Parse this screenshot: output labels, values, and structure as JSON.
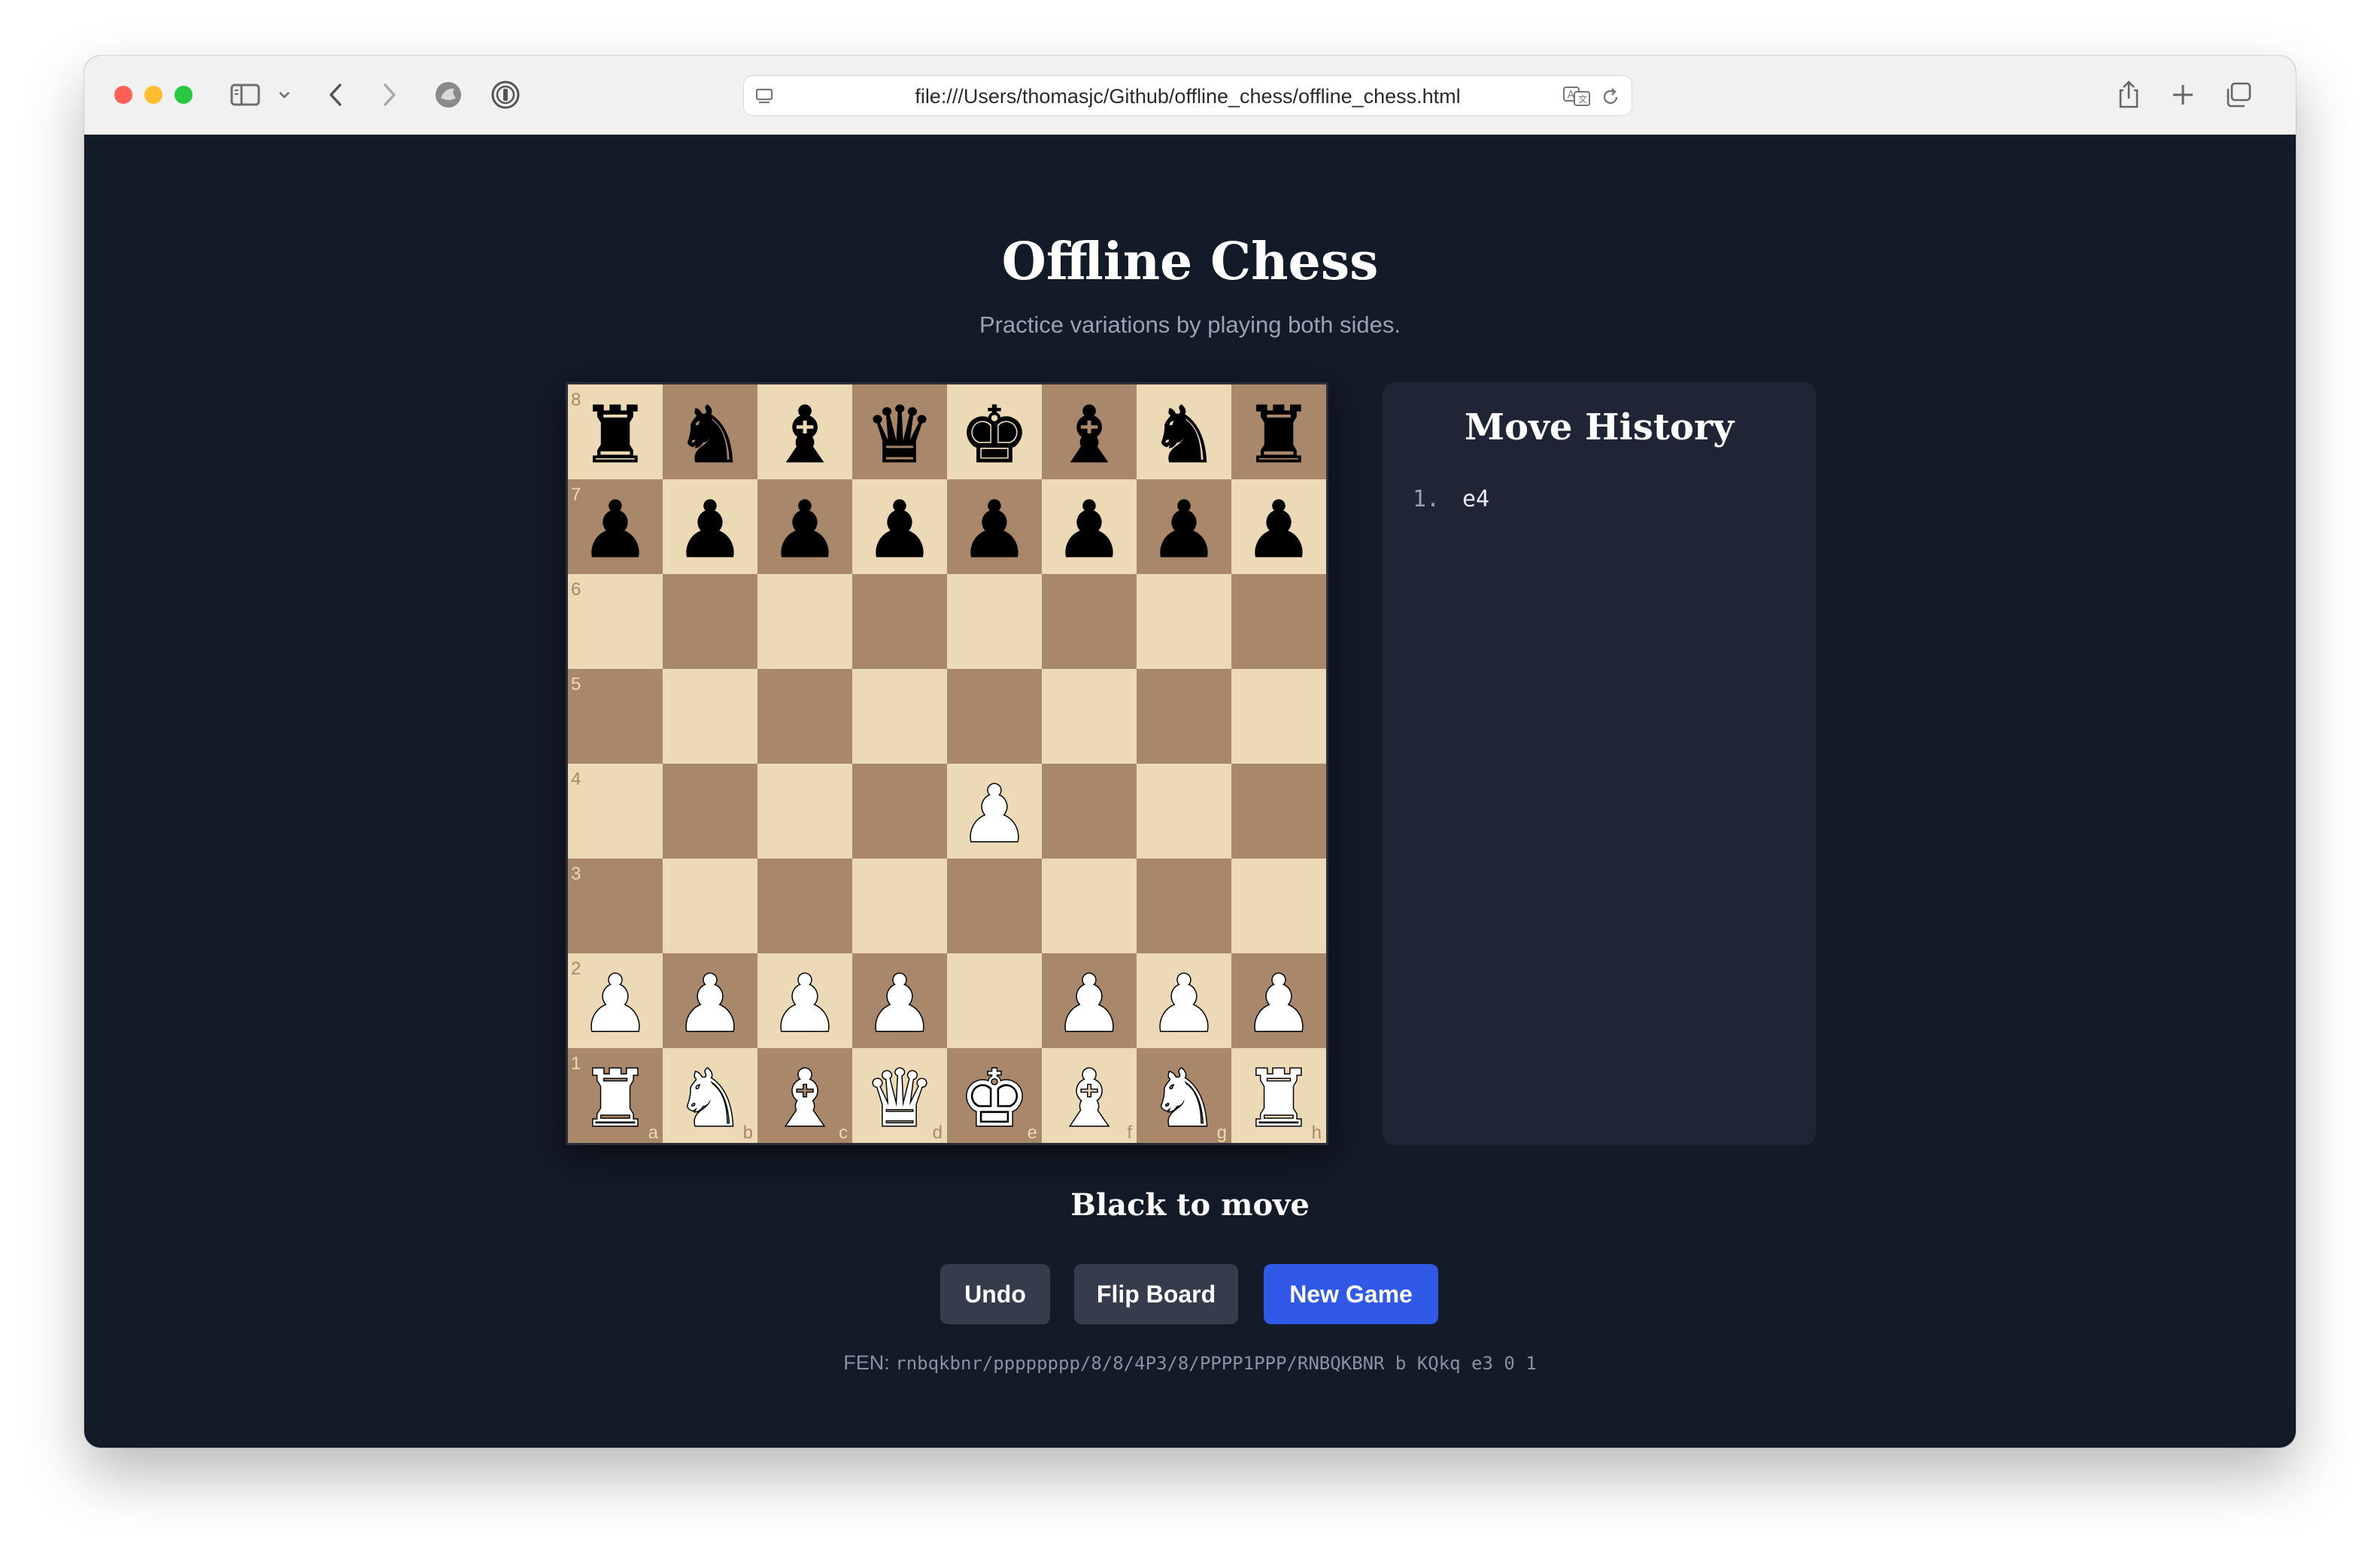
{
  "browser": {
    "url": "file:///Users/thomasjc/Github/offline_chess/offline_chess.html"
  },
  "page": {
    "title": "Offline Chess",
    "subtitle": "Practice variations by playing both sides.",
    "status": "Black to move"
  },
  "board": {
    "light_color": "#ecd9b6",
    "dark_color": "#a9876a",
    "rank_labels": [
      "8",
      "7",
      "6",
      "5",
      "4",
      "3",
      "2",
      "1"
    ],
    "file_labels": [
      "a",
      "b",
      "c",
      "d",
      "e",
      "f",
      "g",
      "h"
    ],
    "position": [
      [
        "r",
        "n",
        "b",
        "q",
        "k",
        "b",
        "n",
        "r"
      ],
      [
        "p",
        "p",
        "p",
        "p",
        "p",
        "p",
        "p",
        "p"
      ],
      [
        "",
        "",
        "",
        "",
        "",
        "",
        "",
        ""
      ],
      [
        "",
        "",
        "",
        "",
        "",
        "",
        "",
        ""
      ],
      [
        "",
        "",
        "",
        "",
        "P",
        "",
        "",
        ""
      ],
      [
        "",
        "",
        "",
        "",
        "",
        "",
        "",
        ""
      ],
      [
        "P",
        "P",
        "P",
        "P",
        "",
        "P",
        "P",
        "P"
      ],
      [
        "R",
        "N",
        "B",
        "Q",
        "K",
        "B",
        "N",
        "R"
      ]
    ]
  },
  "history": {
    "title": "Move History",
    "moves": [
      {
        "number": "1.",
        "white": "e4"
      }
    ]
  },
  "buttons": {
    "undo": "Undo",
    "flip": "Flip Board",
    "new_game": "New Game"
  },
  "fen": {
    "label": "FEN:",
    "value": "rnbqkbnr/pppppppp/8/8/4P3/8/PPPP1PPP/RNBQKBNR b KQkq e3 0 1"
  }
}
